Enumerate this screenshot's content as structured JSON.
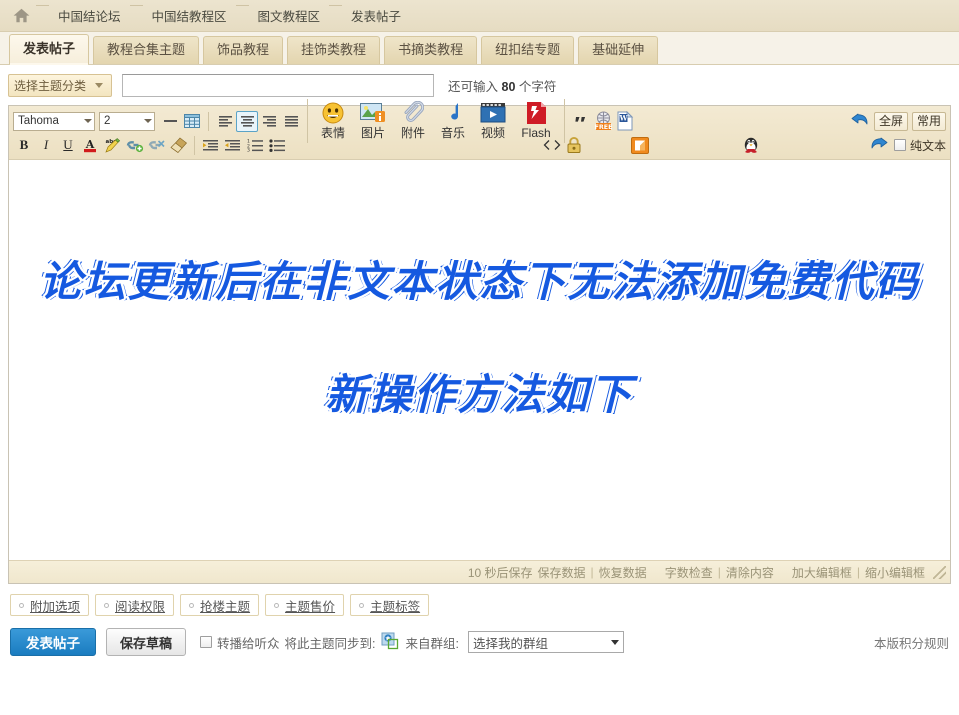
{
  "breadcrumb": {
    "home_icon": "home-icon",
    "items": [
      {
        "label": "中国结论坛"
      },
      {
        "label": "中国结教程区"
      },
      {
        "label": "图文教程区"
      },
      {
        "label": "发表帖子"
      }
    ]
  },
  "tabs": [
    {
      "label": "发表帖子",
      "active": true
    },
    {
      "label": "教程合集主题",
      "active": false
    },
    {
      "label": "饰品教程",
      "active": false
    },
    {
      "label": "挂饰类教程",
      "active": false
    },
    {
      "label": "书摘类教程",
      "active": false
    },
    {
      "label": "纽扣结专题",
      "active": false
    },
    {
      "label": "基础延伸",
      "active": false
    }
  ],
  "subject": {
    "category_label": "选择主题分类",
    "input_value": "",
    "input_placeholder": "",
    "charcount_prefix": "还可输入",
    "charcount_value": "80",
    "charcount_suffix": "个字符"
  },
  "toolbar": {
    "font_family": "Tahoma",
    "font_size": "2",
    "row1_icons": [
      {
        "name": "horizontal-rule-icon",
        "glyph": "—"
      },
      {
        "name": "table-icon",
        "glyph": "▦"
      }
    ],
    "align_icons": [
      {
        "name": "align-left-icon",
        "glyph": "≡",
        "active": false
      },
      {
        "name": "align-center-icon",
        "glyph": "≡",
        "active": true
      },
      {
        "name": "align-right-icon",
        "glyph": "≡",
        "active": false
      },
      {
        "name": "align-justify-icon",
        "glyph": "≡",
        "active": false
      }
    ],
    "format_icons": [
      {
        "name": "bold-icon",
        "glyph": "B"
      },
      {
        "name": "italic-icon",
        "glyph": "I"
      },
      {
        "name": "underline-icon",
        "glyph": "U"
      },
      {
        "name": "font-color-icon",
        "glyph": "A"
      },
      {
        "name": "highlight-color-icon",
        "glyph": "abc"
      },
      {
        "name": "insert-link-icon",
        "glyph": "🔗"
      },
      {
        "name": "remove-link-icon",
        "glyph": "🔗"
      },
      {
        "name": "clear-format-icon",
        "glyph": "🧹"
      }
    ],
    "indent_icons": [
      {
        "name": "outdent-icon",
        "glyph": "⇤"
      },
      {
        "name": "indent-icon",
        "glyph": "⇥"
      },
      {
        "name": "ordered-list-icon",
        "glyph": "1≡"
      },
      {
        "name": "unordered-list-icon",
        "glyph": "•≡"
      }
    ],
    "media_buttons": [
      {
        "name": "smilies-button",
        "label": "表情",
        "icon": "smiley-icon"
      },
      {
        "name": "image-button",
        "label": "图片",
        "icon": "image-icon"
      },
      {
        "name": "attachment-button",
        "label": "附件",
        "icon": "paperclip-icon"
      },
      {
        "name": "music-button",
        "label": "音乐",
        "icon": "music-note-icon"
      },
      {
        "name": "video-button",
        "label": "视频",
        "icon": "film-icon"
      },
      {
        "name": "flash-button",
        "label": "Flash",
        "icon": "flash-icon"
      }
    ],
    "extra_icons": [
      {
        "name": "quote-icon",
        "glyph": "❝"
      },
      {
        "name": "free-code-icon",
        "glyph": "FREE"
      },
      {
        "name": "word-paste-icon",
        "glyph": "W"
      },
      {
        "name": "source-code-icon",
        "glyph": "<>"
      },
      {
        "name": "hide-content-icon",
        "glyph": "🔒"
      },
      {
        "name": "media-box-icon",
        "glyph": "▣"
      },
      {
        "name": "art-text-icon",
        "glyph": "A"
      },
      {
        "name": "qq-icon",
        "glyph": "🐧"
      }
    ],
    "undo_icon": "undo-icon",
    "redo_icon": "redo-icon",
    "fullscreen_label": "全屏",
    "common_label": "常用",
    "plaintext_label": "纯文本",
    "plaintext_checked": false
  },
  "document": {
    "line1": "论坛更新后在非文本状态下无法添加免费代码",
    "line2": "新操作方法如下"
  },
  "editor_status": {
    "autosave": "10 秒后保存",
    "save_data": "保存数据",
    "restore_data": "恢复数据",
    "word_check": "字数检查",
    "clear_content": "清除内容",
    "enlarge_box": "加大编辑框",
    "shrink_box": "缩小编辑框",
    "divider": "|"
  },
  "options": [
    {
      "label": "附加选项"
    },
    {
      "label": "阅读权限"
    },
    {
      "label": "抢楼主题"
    },
    {
      "label": "主题售价"
    },
    {
      "label": "主题标签"
    }
  ],
  "bottom": {
    "post_label": "发表帖子",
    "draft_label": "保存草稿",
    "broadcast_checked": false,
    "broadcast_label": "转播给听众",
    "sync_label": "将此主题同步到:",
    "sync_icon": "qzone-icon",
    "from_group_label": "来自群组:",
    "group_select_value": "选择我的群组",
    "credit_rule_label": "本版积分规则"
  },
  "colors": {
    "accent_blue": "#1a7cc0",
    "breadcrumb_bg": "#ece4cf",
    "toolbar_bg": "#f1e7cd",
    "tab_active_bg": "#fdf8ec",
    "doc_text": "#1559e0"
  }
}
